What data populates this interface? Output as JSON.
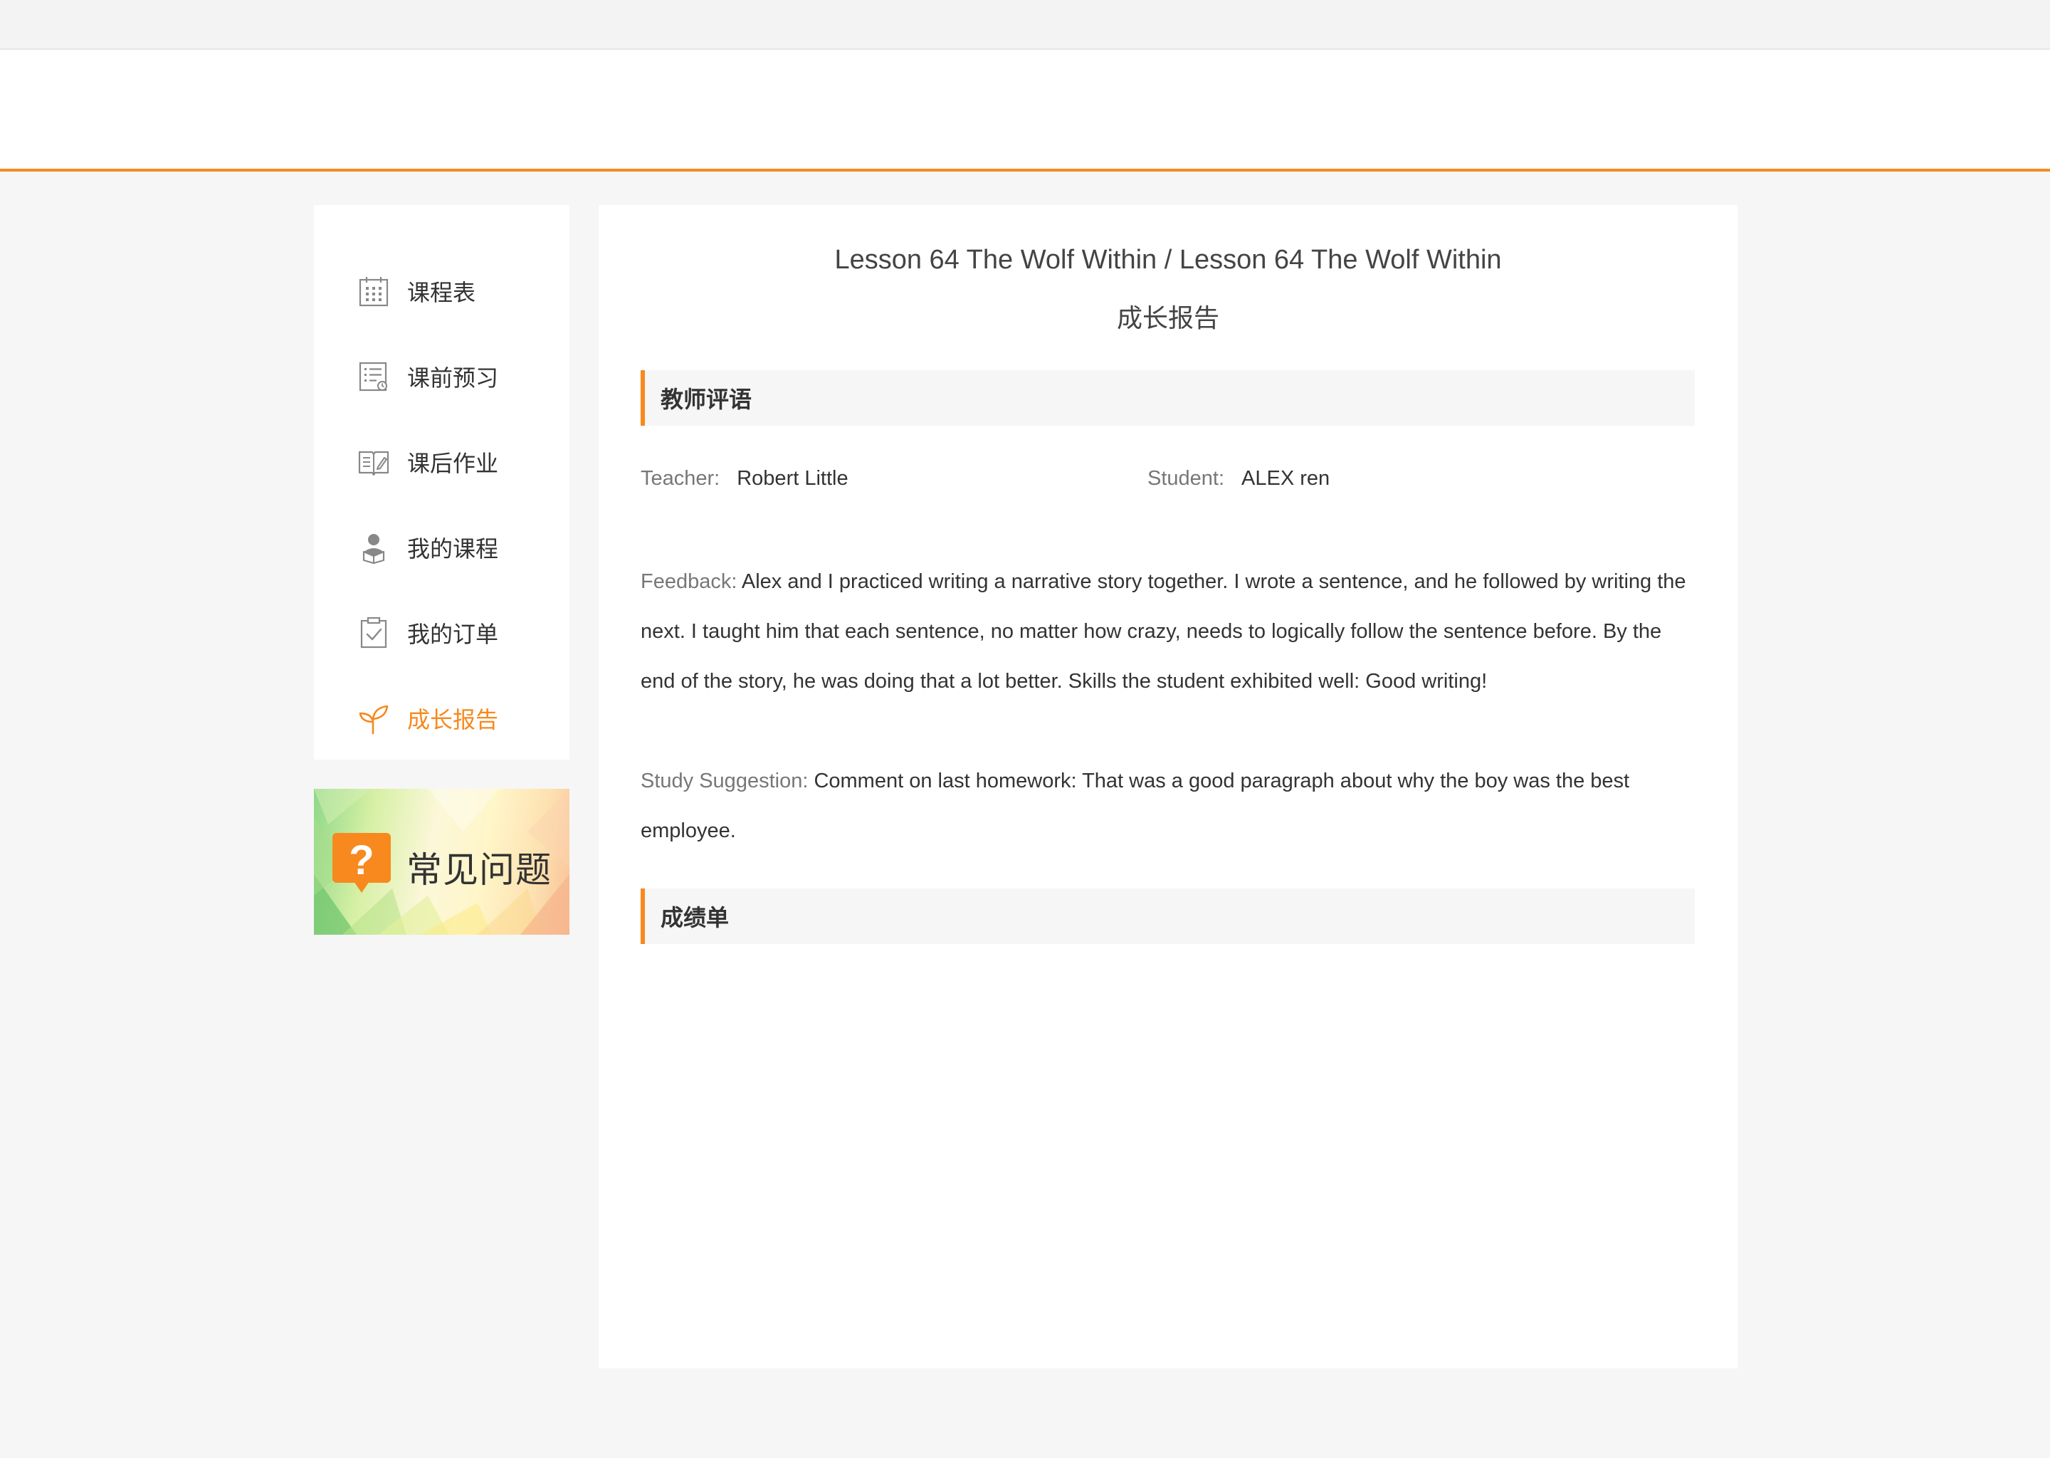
{
  "sidebar": {
    "items": [
      {
        "label": "课程表",
        "icon": "calendar-icon"
      },
      {
        "label": "课前预习",
        "icon": "checklist-icon"
      },
      {
        "label": "课后作业",
        "icon": "open-book-icon"
      },
      {
        "label": "我的课程",
        "icon": "student-icon"
      },
      {
        "label": "我的订单",
        "icon": "clipboard-check-icon"
      },
      {
        "label": "成长报告",
        "icon": "sprout-icon",
        "active": true
      }
    ]
  },
  "faq": {
    "label": "常见问题",
    "icon": "question-bubble-icon"
  },
  "report": {
    "lesson_title": "Lesson 64 The Wolf Within / Lesson 64 The Wolf Within",
    "title": "成长报告",
    "teacher_comments_header": "教师评语",
    "teacher_label": "Teacher:",
    "teacher_name": "Robert Little",
    "student_label": "Student:",
    "student_name": "ALEX ren",
    "feedback_label": "Feedback:",
    "feedback_text": "Alex and I practiced writing a narrative story together. I wrote a sentence, and he followed by writing the next. I taught him that each sentence, no matter how crazy, needs to logically follow the sentence before. By the end of the story, he was doing that a lot better. Skills the student exhibited well: Good writing!",
    "suggestion_label": "Study Suggestion:",
    "suggestion_text": "Comment on last homework: That was a good paragraph about why the boy was the best employee.",
    "transcript_header": "成绩单"
  },
  "colors": {
    "accent": "#f7891f",
    "text": "#333333",
    "muted": "#777777",
    "page_bg": "#f6f6f6",
    "section_bg": "#f6f6f6"
  }
}
